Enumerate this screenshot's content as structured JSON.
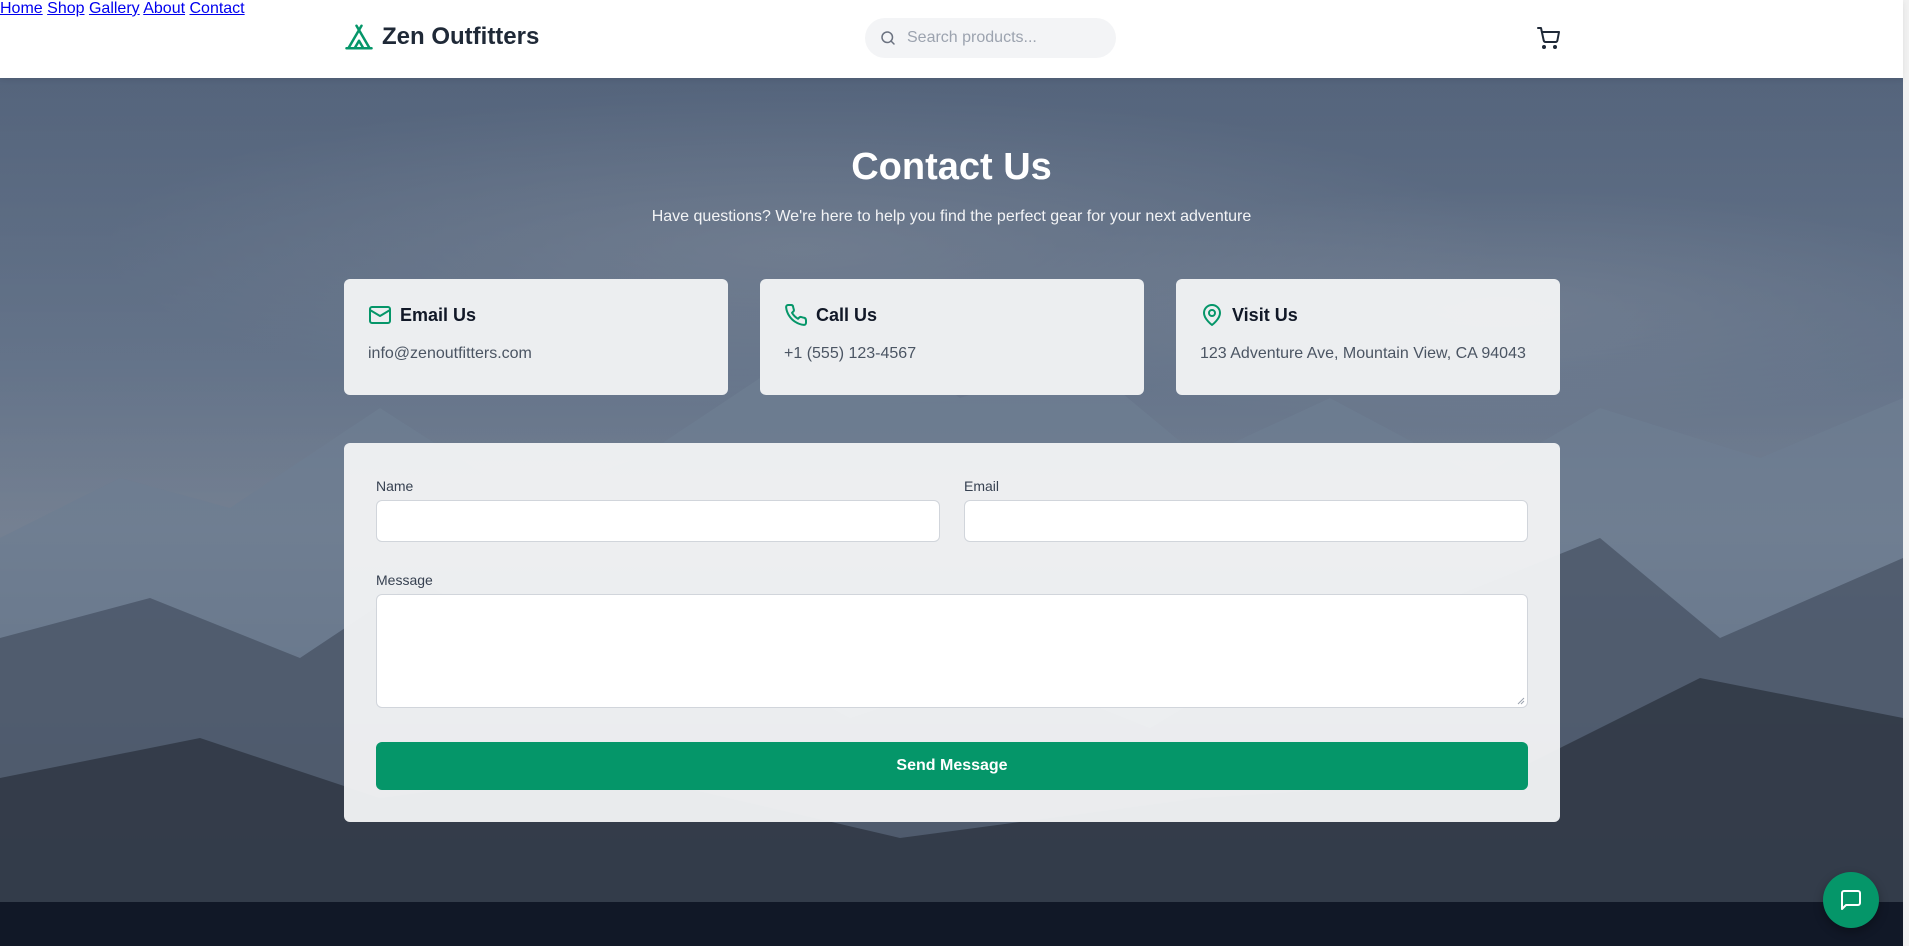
{
  "header": {
    "brand": "Zen Outfitters",
    "search_placeholder": "Search products...",
    "nav": [
      "Home",
      "Shop",
      "Gallery",
      "About",
      "Contact"
    ]
  },
  "hero": {
    "title": "Contact Us",
    "subtitle": "Have questions? We're here to help you find the perfect gear for your next adventure"
  },
  "cards": [
    {
      "title": "Email Us",
      "value": "info@zenoutfitters.com",
      "icon": "mail-icon"
    },
    {
      "title": "Call Us",
      "value": "+1 (555) 123-4567",
      "icon": "phone-icon"
    },
    {
      "title": "Visit Us",
      "value": "123 Adventure Ave, Mountain View, CA 94043",
      "icon": "map-pin-icon"
    }
  ],
  "form": {
    "name_label": "Name",
    "email_label": "Email",
    "message_label": "Message",
    "name_value": "",
    "email_value": "",
    "message_value": "",
    "submit_label": "Send Message"
  },
  "colors": {
    "accent": "#059669",
    "footer": "#111827"
  }
}
